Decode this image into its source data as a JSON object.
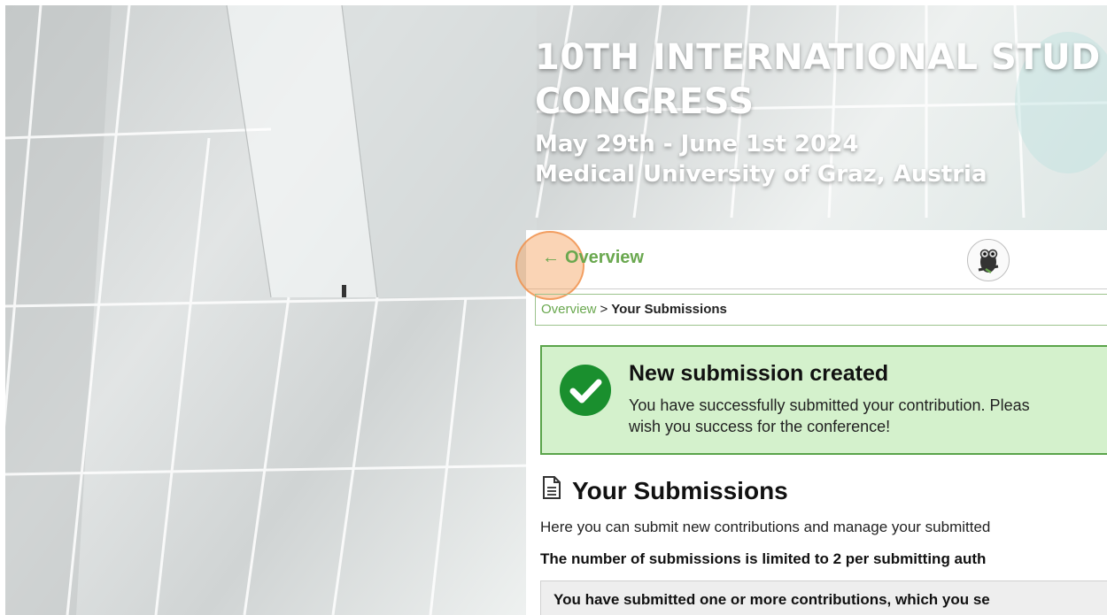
{
  "hero": {
    "title_line1": "10TH INTERNATIONAL STUD",
    "title_line2": "CONGRESS",
    "dates": "May 29th - June 1st 2024",
    "venue": "Medical University of Graz, Austria"
  },
  "topbar": {
    "back_label": "Overview",
    "back_arrow": "←",
    "logo_icon": "owl-logo-icon"
  },
  "breadcrumb": {
    "link": "Overview",
    "separator": ">",
    "current": "Your Submissions"
  },
  "alert": {
    "title": "New submission created",
    "line1": "You have successfully submitted your contribution. Pleas",
    "line2": "wish you success for the conference!",
    "icon": "check-circle-icon",
    "color": "#1a8f2e"
  },
  "section": {
    "title": "Your Submissions",
    "icon": "document-icon",
    "intro": "Here you can submit new contributions and manage your submitted",
    "limit": "The number of submissions is limited to 2 per submitting auth",
    "info": "You have submitted one or more contributions, which you se"
  },
  "colors": {
    "accent": "#6aa84f",
    "alert_bg": "#d4f1cc",
    "alert_border": "#5aa44a"
  }
}
